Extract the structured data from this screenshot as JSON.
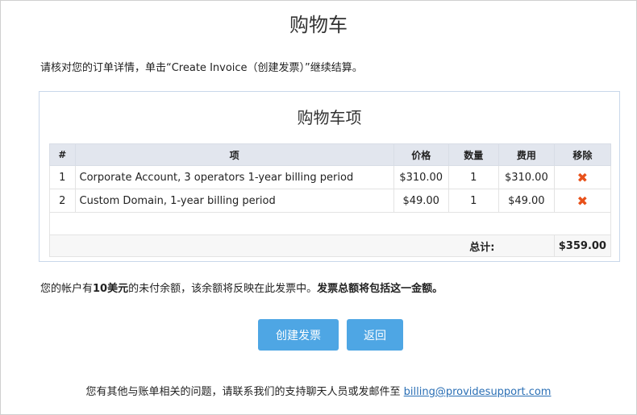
{
  "page_title": "购物车",
  "intro": "请核对您的订单详情，单击“Create Invoice（创建发票）”继续结算。",
  "cart": {
    "title": "购物车项",
    "columns": {
      "num": "#",
      "item": "项",
      "price": "价格",
      "qty": "数量",
      "cost": "费用",
      "remove": "移除"
    },
    "rows": [
      {
        "num": "1",
        "item": "Corporate Account, 3 operators 1-year billing period",
        "price": "$310.00",
        "qty": "1",
        "cost": "$310.00",
        "remove": "✖"
      },
      {
        "num": "2",
        "item": "Custom Domain, 1-year billing period",
        "price": "$49.00",
        "qty": "1",
        "cost": "$49.00",
        "remove": "✖"
      }
    ],
    "total_label": "总计:",
    "total_value": "$359.00"
  },
  "balance": {
    "prefix": "您的帐户有",
    "amount": "10美元",
    "middle": "的未付余额，该余额将反映在此发票中。",
    "emphasis": "发票总额将包括这一金额。"
  },
  "buttons": {
    "create": "创建发票",
    "back": "返回"
  },
  "footer": {
    "text": "您有其他与账单相关的问题，请联系我们的支持聊天人员或发邮件至 ",
    "email": "billing@providesupport.com"
  },
  "colors": {
    "accent": "#4ea6e4",
    "remove": "#e8511a",
    "link": "#2a6fb5",
    "header_bg": "#e2e6ee"
  }
}
